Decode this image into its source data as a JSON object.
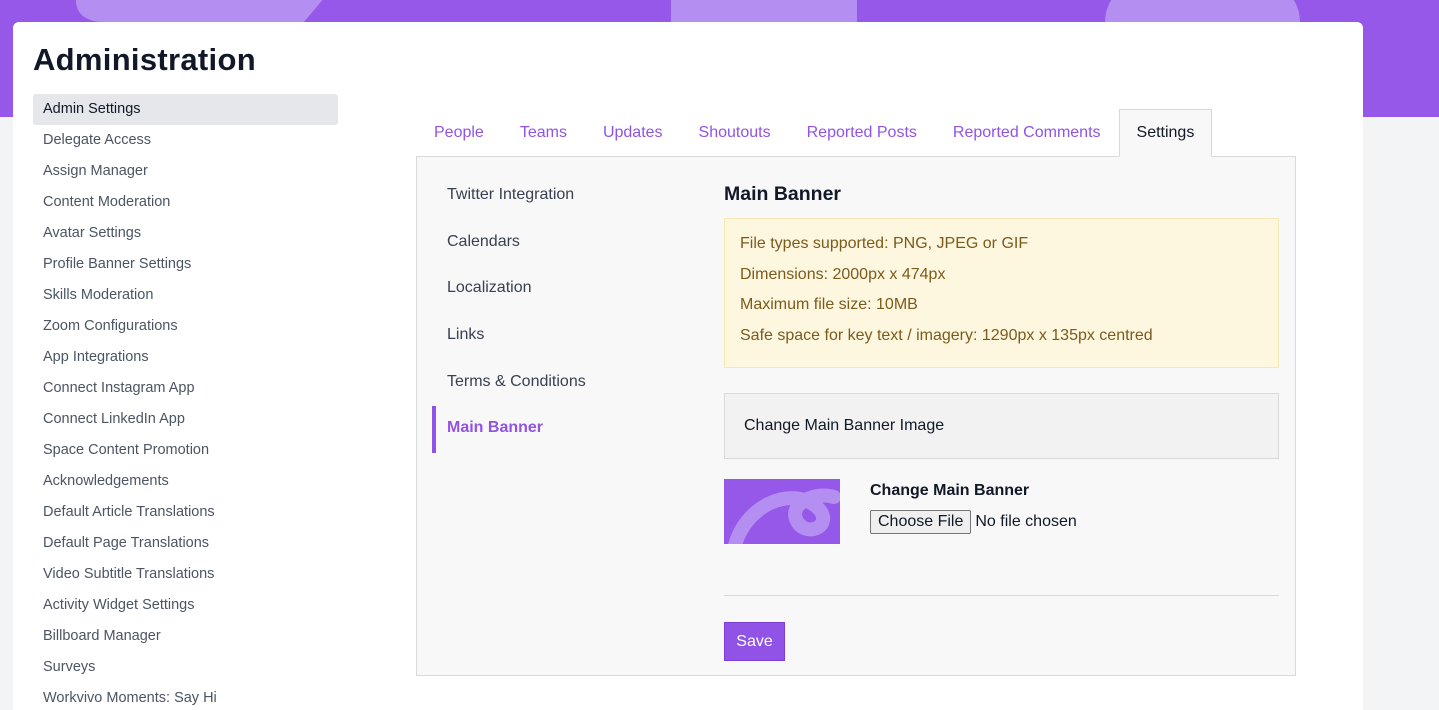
{
  "page": {
    "title": "Administration"
  },
  "sidebar": {
    "items": [
      {
        "label": "Admin Settings",
        "active": true
      },
      {
        "label": "Delegate Access"
      },
      {
        "label": "Assign Manager"
      },
      {
        "label": "Content Moderation"
      },
      {
        "label": "Avatar Settings"
      },
      {
        "label": "Profile Banner Settings"
      },
      {
        "label": "Skills Moderation"
      },
      {
        "label": "Zoom Configurations"
      },
      {
        "label": "App Integrations"
      },
      {
        "label": "Connect Instagram App"
      },
      {
        "label": "Connect LinkedIn App"
      },
      {
        "label": "Space Content Promotion"
      },
      {
        "label": "Acknowledgements"
      },
      {
        "label": "Default Article Translations"
      },
      {
        "label": "Default Page Translations"
      },
      {
        "label": "Video Subtitle Translations"
      },
      {
        "label": "Activity Widget Settings"
      },
      {
        "label": "Billboard Manager"
      },
      {
        "label": "Surveys"
      },
      {
        "label": "Workvivo Moments: Say Hi"
      }
    ]
  },
  "tabs": [
    {
      "label": "People"
    },
    {
      "label": "Teams"
    },
    {
      "label": "Updates"
    },
    {
      "label": "Shoutouts"
    },
    {
      "label": "Reported Posts"
    },
    {
      "label": "Reported Comments"
    },
    {
      "label": "Settings",
      "active": true
    }
  ],
  "settings_nav": {
    "items": [
      {
        "label": "Twitter Integration"
      },
      {
        "label": "Calendars"
      },
      {
        "label": "Localization"
      },
      {
        "label": "Links"
      },
      {
        "label": "Terms & Conditions"
      },
      {
        "label": "Main Banner",
        "active": true
      }
    ]
  },
  "main_banner": {
    "title": "Main Banner",
    "info": [
      "File types supported: PNG, JPEG or GIF",
      "Dimensions: 2000px x 474px",
      "Maximum file size: 10MB",
      "Safe space for key text / imagery: 1290px x 135px centred"
    ],
    "change_heading": "Change Main Banner Image",
    "upload_label": "Change Main Banner",
    "file_button": "Choose File",
    "file_status": "No file chosen",
    "save_label": "Save"
  },
  "colors": {
    "brand": "#9558e9",
    "brand_light": "#b48ef0",
    "link": "#9153e6",
    "info_bg": "#fef7e0",
    "info_text": "#7c5a1b"
  }
}
